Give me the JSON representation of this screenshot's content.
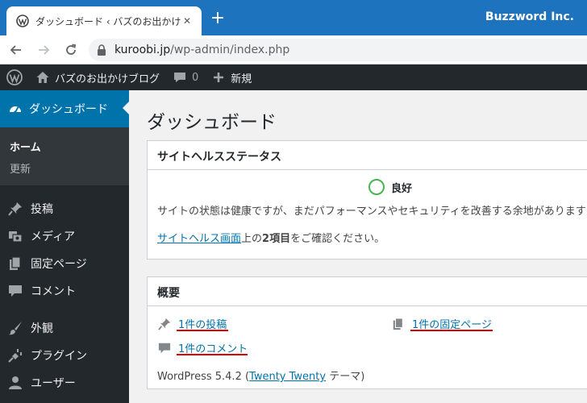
{
  "browser": {
    "tab_title": "ダッシュボード ‹ バズのお出かけブログ —",
    "window_title": "Buzzword Inc.",
    "url_host": "kuroobi.jp",
    "url_path": "/wp-admin/index.php"
  },
  "adminbar": {
    "site_name": "バズのお出かけブログ",
    "comments_count": "0",
    "new_label": "新規"
  },
  "menu": {
    "current": "ダッシュボード",
    "sub_home": "ホーム",
    "sub_updates": "更新",
    "items": [
      "投稿",
      "メディア",
      "固定ページ",
      "コメント",
      "外観",
      "プラグイン",
      "ユーザー"
    ]
  },
  "page": {
    "title": "ダッシュボード"
  },
  "health": {
    "heading": "サイトヘルスステータス",
    "status": "良好",
    "description": "サイトの状態は健康ですが、まだパフォーマンスやセキュリティを改善する余地があります",
    "link_text": "サイトヘルス画面",
    "link_suffix_1": "上の",
    "link_bold": "2項目",
    "link_suffix_2": "をご確認ください。"
  },
  "glance": {
    "heading": "概要",
    "posts": "1件の投稿",
    "pages": "1件の固定ページ",
    "comments": "1件のコメント",
    "version_prefix": "WordPress 5.4.2 (",
    "theme": "Twenty Twenty",
    "version_suffix": " テーマ)"
  },
  "colors": {
    "titlebar": "#1e73be",
    "adminbar": "#23282d",
    "accent": "#0073aa",
    "health_good": "#46b450",
    "annotation": "#e00000"
  }
}
